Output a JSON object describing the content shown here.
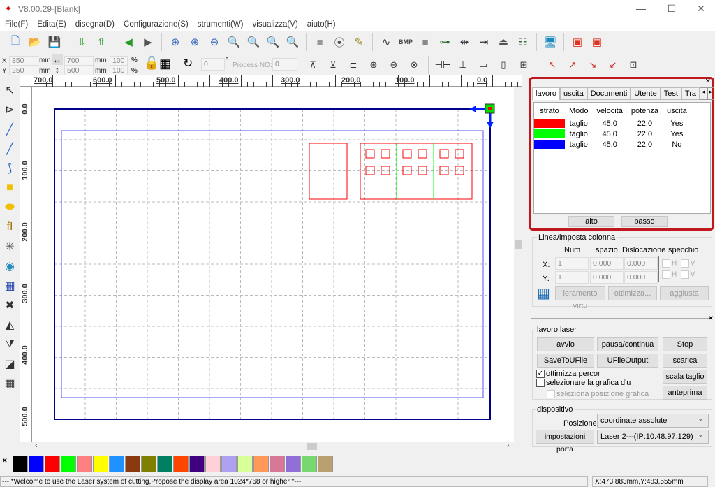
{
  "window": {
    "title": "V8.00.29-[Blank]",
    "minimize": "—",
    "maximize": "☐",
    "close": "✕"
  },
  "menu": [
    "File(F)",
    "Edita(E)",
    "disegna(D)",
    "Configurazione(S)",
    "strumenti(W)",
    "visualizza(V)",
    "aiuto(H)"
  ],
  "toolbar1": [
    {
      "name": "new-file-icon",
      "glyph": "🗋",
      "color": "#3a7bd5"
    },
    {
      "name": "open-folder-icon",
      "glyph": "📂",
      "color": "#e8a820"
    },
    {
      "name": "save-icon",
      "glyph": "💾",
      "color": "#2a3fa0"
    },
    {
      "sep": true
    },
    {
      "name": "import-icon",
      "glyph": "⇩",
      "color": "#2a9a2a"
    },
    {
      "name": "export-icon",
      "glyph": "⇧",
      "color": "#2a9a2a"
    },
    {
      "sep": true
    },
    {
      "name": "undo-icon",
      "glyph": "◀",
      "color": "#2a9a2a"
    },
    {
      "name": "redo-icon",
      "glyph": "▶",
      "color": "#555"
    },
    {
      "sep": true
    },
    {
      "name": "zoom-select-icon",
      "glyph": "⊕",
      "color": "#3a6ac0"
    },
    {
      "name": "zoom-in-icon",
      "glyph": "⊕",
      "color": "#3a6ac0"
    },
    {
      "name": "zoom-out-icon",
      "glyph": "⊖",
      "color": "#3a6ac0"
    },
    {
      "name": "zoom-page-icon",
      "glyph": "🔍",
      "color": "#3a6ac0"
    },
    {
      "name": "zoom-grid-icon",
      "glyph": "🔍",
      "color": "#666"
    },
    {
      "name": "zoom-all-icon",
      "glyph": "🔍",
      "color": "#3a6ac0"
    },
    {
      "name": "zoom-fit-icon",
      "glyph": "🔍",
      "color": "#3a6ac0"
    },
    {
      "sep": true
    },
    {
      "name": "select-rect-icon",
      "glyph": "■",
      "color": "#999"
    },
    {
      "name": "node-icon",
      "glyph": "⦿",
      "color": "#555"
    },
    {
      "name": "pen-icon",
      "glyph": "✎",
      "color": "#9a8a20"
    },
    {
      "sep": true
    },
    {
      "name": "curve-icon",
      "glyph": "∿",
      "color": "#333"
    },
    {
      "name": "bmp-icon",
      "glyph": "BMP",
      "color": "#444"
    },
    {
      "name": "fill-icon",
      "glyph": "■",
      "color": "#888"
    },
    {
      "name": "connect-icon",
      "glyph": "⊶",
      "color": "#2a6a2a"
    },
    {
      "name": "distance-icon",
      "glyph": "⇹",
      "color": "#333"
    },
    {
      "name": "align-icon",
      "glyph": "⇥",
      "color": "#333"
    },
    {
      "name": "laser-head-icon",
      "glyph": "⏏",
      "color": "#555"
    },
    {
      "name": "list-icon",
      "glyph": "☷",
      "color": "#3a6a3a"
    },
    {
      "sep": true
    },
    {
      "name": "monitor-icon",
      "glyph": "🖥",
      "color": "#1a8ac0"
    },
    {
      "sep": true
    },
    {
      "name": "group-icon",
      "glyph": "▣",
      "color": "#e03020"
    },
    {
      "name": "ungroup-icon",
      "glyph": "▣",
      "color": "#e03020"
    }
  ],
  "toolbar2": {
    "x_label": "X",
    "y_label": "Y",
    "x_value": "350",
    "y_value": "250",
    "unit": "mm",
    "width_value": "700",
    "height_value": "500",
    "scale_x": "100",
    "scale_y": "100",
    "percent": "%",
    "rotation": "0",
    "degree": "°",
    "process_label": "Process NO:",
    "process_value": "0",
    "icons": [
      "align-top-icon",
      "align-bottom-icon",
      "align-left-icon",
      "align-center-h-icon",
      "align-center-v-icon",
      "align-center-icon",
      "equal-space-h-icon",
      "equal-space-v-icon",
      "same-width-icon",
      "same-height-icon",
      "same-size-icon",
      "corner-top-left-icon",
      "corner-top-right-icon",
      "corner-bottom-right-icon",
      "corner-bottom-left-icon",
      "center-icon"
    ],
    "glyphs": [
      "⊼",
      "⊻",
      "⊏",
      "⊕",
      "⊖",
      "⊗",
      "⊣⊢",
      "⊥",
      "▭",
      "▯",
      "⊞",
      "↖",
      "↗",
      "↘",
      "↙",
      "⊡"
    ]
  },
  "left_tools": [
    {
      "name": "select-arrow-icon",
      "glyph": "↖",
      "color": "#333"
    },
    {
      "name": "node-edit-icon",
      "glyph": "⊳",
      "color": "#333"
    },
    {
      "name": "line-icon",
      "glyph": "╱",
      "color": "#2a6ac0"
    },
    {
      "name": "polyline-icon",
      "glyph": "╱",
      "color": "#2a6ac0"
    },
    {
      "name": "curve-tool-icon",
      "glyph": "⟆",
      "color": "#2a6ac0"
    },
    {
      "name": "rectangle-icon",
      "glyph": "■",
      "color": "#f0c000"
    },
    {
      "name": "ellipse-icon",
      "glyph": "⬬",
      "color": "#f0c000"
    },
    {
      "name": "text-icon",
      "glyph": "fI",
      "color": "#a07000"
    },
    {
      "name": "point-icon",
      "glyph": "✳",
      "color": "#555"
    },
    {
      "name": "camera-icon",
      "glyph": "◉",
      "color": "#2a8ac0"
    },
    {
      "name": "array-grid-icon",
      "glyph": "▦",
      "color": "#2a4ab0"
    },
    {
      "name": "delete-icon",
      "glyph": "✖",
      "color": "#333"
    },
    {
      "name": "mirror-h-icon",
      "glyph": "◭",
      "color": "#333"
    },
    {
      "name": "mirror-v-icon",
      "glyph": "⧩",
      "color": "#333"
    },
    {
      "name": "shadow-icon",
      "glyph": "◪",
      "color": "#333"
    },
    {
      "name": "array-icon",
      "glyph": "▦",
      "color": "#444"
    }
  ],
  "rulers": {
    "top": [
      "700.0",
      "600.0",
      "500.0",
      "400.0",
      "300.0",
      "200.0",
      "100.0",
      "0.0"
    ],
    "left": [
      "0.0",
      "100.0",
      "200.0",
      "300.0",
      "400.0",
      "500.0"
    ]
  },
  "layer_panel": {
    "tabs": [
      "lavoro",
      "uscita",
      "Documenti",
      "Utente",
      "Test",
      "Tra"
    ],
    "active_tab": "lavoro",
    "headers": [
      "strato",
      "Modo",
      "velocità",
      "potenza",
      "uscita"
    ],
    "rows": [
      {
        "color": "#ff0000",
        "mode": "taglio",
        "speed": "45.0",
        "power": "22.0",
        "output": "Yes"
      },
      {
        "color": "#00ff00",
        "mode": "taglio",
        "speed": "45.0",
        "power": "22.0",
        "output": "Yes"
      },
      {
        "color": "#0000ff",
        "mode": "taglio",
        "speed": "45.0",
        "power": "22.0",
        "output": "No"
      }
    ],
    "up": "alto",
    "down": "basso",
    "highlight_color": "#c0181e"
  },
  "array_panel": {
    "title": "Linea/imposta colonna",
    "num": "Num",
    "space": "spazio",
    "offset": "Dislocazione",
    "mirror": "specchio",
    "x": "X:",
    "y": "Y:",
    "x_num": "1",
    "x_space": "0.000",
    "x_offset": "0.000",
    "y_num": "1",
    "y_space": "0.000",
    "y_offset": "0.000",
    "h": "H",
    "v": "V",
    "virtual_btn": "ieramento virtu",
    "optimize_btn": "ottimizza...",
    "adjust_btn": "aggiusta"
  },
  "laser_panel": {
    "title": "lavoro laser",
    "start": "avvio",
    "pause": "pausa/continua",
    "stop": "Stop",
    "save_u": "SaveToUFile",
    "u_output": "UFileOutput",
    "download": "scarica",
    "opt_path": "ottimizza percor",
    "opt_path_checked": true,
    "select_graphic": "selezionare la grafica d'u",
    "select_graphic_checked": false,
    "select_pos": "seleziona posizione grafica",
    "scale_cut": "scala taglio",
    "preview": "anteprima"
  },
  "device_panel": {
    "title": "dispositivo",
    "pos_label": "Posizione:",
    "pos_value": "coordinate assolute",
    "port_btn": "impostazioni porta",
    "laser_value": "Laser 2---(IP:10.48.97.129)"
  },
  "palette": [
    "#000000",
    "#0000ff",
    "#ff0000",
    "#00ff00",
    "#ff8080",
    "#ffff00",
    "#1e90ff",
    "#8b3a10",
    "#808000",
    "#008060",
    "#ff4500",
    "#400080",
    "#ffd0d8",
    "#b0a0f0",
    "#d8ff98",
    "#ff9858",
    "#d87898",
    "#9070d8",
    "#78d870",
    "#b8a070"
  ],
  "status": {
    "message": "--- *Welcome to use the Laser system of cutting,Propose the display area 1024*768 or higher *---",
    "coords": "X:473.883mm,Y:483.555mm"
  }
}
